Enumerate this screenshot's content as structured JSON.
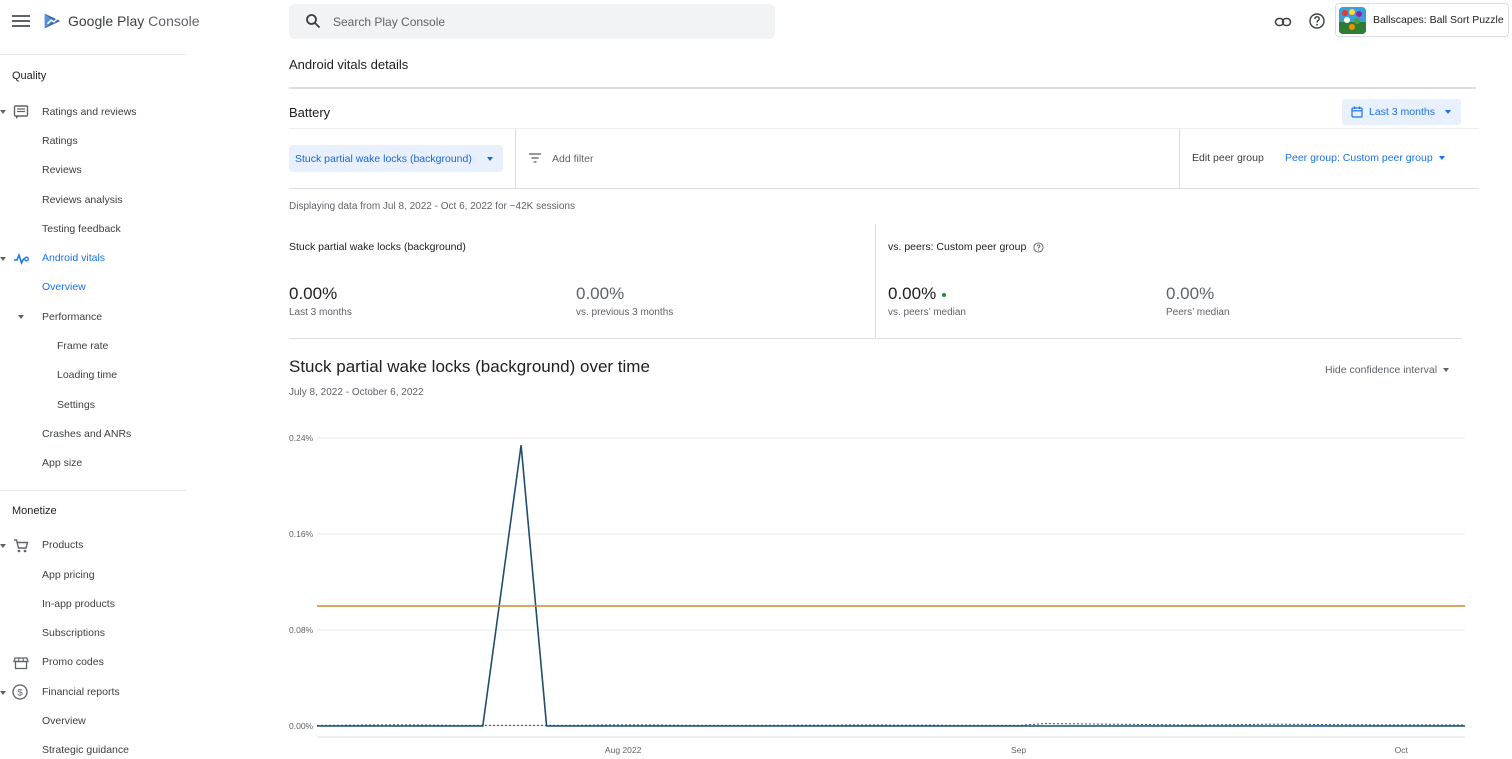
{
  "topbar": {
    "brand_main": "Google Play",
    "brand_sub": "Console",
    "search_placeholder": "Search Play Console",
    "app_name": "Ballscapes: Ball Sort Puzzle"
  },
  "sidebar": {
    "sections": [
      {
        "title": "Quality"
      },
      {
        "title": "Monetize"
      }
    ],
    "items": [
      {
        "label": "Ratings and reviews",
        "icon": "reviews-icon"
      },
      {
        "label": "Ratings"
      },
      {
        "label": "Reviews"
      },
      {
        "label": "Reviews analysis"
      },
      {
        "label": "Testing feedback"
      },
      {
        "label": "Android vitals",
        "icon": "vitals-icon",
        "active": true
      },
      {
        "label": "Overview",
        "active": true
      },
      {
        "label": "Performance"
      },
      {
        "label": "Frame rate"
      },
      {
        "label": "Loading time"
      },
      {
        "label": "Settings"
      },
      {
        "label": "Crashes and ANRs"
      },
      {
        "label": "App size"
      },
      {
        "label": "Products",
        "icon": "cart-icon"
      },
      {
        "label": "App pricing"
      },
      {
        "label": "In-app products"
      },
      {
        "label": "Subscriptions"
      },
      {
        "label": "Promo codes",
        "icon": "store-icon"
      },
      {
        "label": "Financial reports",
        "icon": "dollar-icon"
      },
      {
        "label": "Overview"
      },
      {
        "label": "Strategic guidance"
      }
    ]
  },
  "main": {
    "page_title": "Android vitals details",
    "section_title": "Battery",
    "date_range_button": "Last 3 months",
    "metric_selector": "Stuck partial wake locks (background)",
    "add_filter": "Add filter",
    "edit_peer_group": "Edit peer group",
    "peer_group_selector": "Peer group: Custom peer group",
    "display_note": "Displaying data from Jul 8, 2022 - Oct 6, 2022 for ~42K sessions",
    "metric_card_title": "Stuck partial wake locks (background)",
    "peer_card_title": "vs. peers: Custom peer group",
    "stats": [
      {
        "value": "0.00%",
        "label": "Last 3 months"
      },
      {
        "value": "0.00%",
        "label": "vs. previous 3 months"
      },
      {
        "value": "0.00%",
        "label": "vs. peers’ median"
      },
      {
        "value": "0.00%",
        "label": "Peers’ median"
      }
    ],
    "chart_title": "Stuck partial wake locks (background) over time",
    "chart_subtitle": "July 8, 2022 - October 6, 2022",
    "confidence_toggle": "Hide confidence interval"
  },
  "colors": {
    "accent": "#1a73e8",
    "series_main": "#1f4e6b",
    "peer_median": "#c98a2a",
    "good": "#1e8e3e"
  },
  "chart_data": {
    "type": "line",
    "title": "Stuck partial wake locks (background) over time",
    "subtitle": "July 8, 2022 - October 6, 2022",
    "ylim": [
      0,
      0.24
    ],
    "yticks": [
      "0.00%",
      "0.08%",
      "0.16%",
      "0.24%"
    ],
    "ytick_values": [
      0,
      0.08,
      0.16,
      0.24
    ],
    "xlim": [
      "2022-07-08",
      "2022-10-06"
    ],
    "xticks": [
      {
        "label": "Aug 2022",
        "date": "2022-08-01"
      },
      {
        "label": "Sep",
        "date": "2022-09-01"
      },
      {
        "label": "Oct",
        "date": "2022-10-01"
      }
    ],
    "grid": true,
    "series": [
      {
        "style": "solid",
        "color": "#1f4e6b",
        "points": [
          [
            "2022-07-08",
            0.0
          ],
          [
            "2022-07-15",
            0.0
          ],
          [
            "2022-07-21",
            0.0
          ],
          [
            "2022-07-24",
            0.234
          ],
          [
            "2022-07-26",
            0.0
          ],
          [
            "2022-08-10",
            0.0
          ],
          [
            "2022-08-25",
            0.0
          ],
          [
            "2022-09-10",
            0.0
          ],
          [
            "2022-09-25",
            0.0
          ],
          [
            "2022-10-06",
            0.0
          ]
        ]
      },
      {
        "style": "dashed",
        "color": "#1f4e6b",
        "points": [
          [
            "2022-07-08",
            0.0005
          ],
          [
            "2022-07-14",
            0.001
          ],
          [
            "2022-07-20",
            0.0005
          ],
          [
            "2022-07-27",
            0.0005
          ],
          [
            "2022-08-01",
            0.001
          ],
          [
            "2022-08-08",
            0.0005
          ],
          [
            "2022-08-20",
            0.0008
          ],
          [
            "2022-09-01",
            0.0005
          ],
          [
            "2022-09-03",
            0.002
          ],
          [
            "2022-09-15",
            0.0008
          ],
          [
            "2022-09-21",
            0.0015
          ],
          [
            "2022-09-28",
            0.001
          ],
          [
            "2022-10-06",
            0.0008
          ]
        ]
      },
      {
        "style": "solid",
        "color": "#c98a2a",
        "points": [
          [
            "2022-07-08",
            0.1
          ],
          [
            "2022-10-06",
            0.1
          ]
        ]
      }
    ]
  }
}
